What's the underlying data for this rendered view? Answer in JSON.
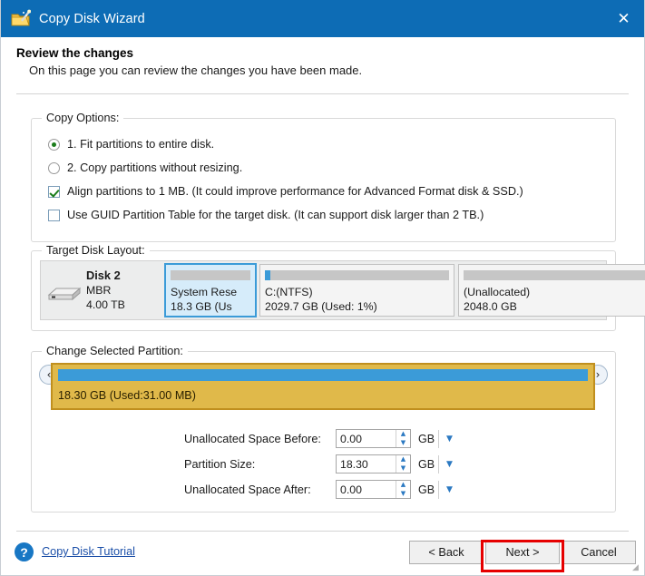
{
  "window": {
    "title": "Copy Disk Wizard",
    "icon": "wizard-disk-icon",
    "close_label": "✕",
    "accent_color": "#0d6cb5"
  },
  "header": {
    "heading": "Review the changes",
    "subheading": "On this page you can review the changes you have been made."
  },
  "copy_options": {
    "legend": "Copy Options:",
    "items": [
      {
        "type": "radio",
        "checked": true,
        "label": "1. Fit partitions to entire disk."
      },
      {
        "type": "radio",
        "checked": false,
        "label": "2. Copy partitions without resizing."
      },
      {
        "type": "checkbox",
        "checked": true,
        "label": "Align partitions to 1 MB.  (It could improve performance for Advanced Format disk & SSD.)"
      },
      {
        "type": "checkbox",
        "checked": false,
        "label": "Use GUID Partition Table for the target disk. (It can support disk larger than 2 TB.)"
      }
    ]
  },
  "target_disk": {
    "legend": "Target Disk Layout:",
    "disk": {
      "name": "Disk 2",
      "scheme": "MBR",
      "size": "4.00 TB"
    },
    "partitions": [
      {
        "name": "System Rese",
        "size": "18.3 GB (Us",
        "used_pct": 0,
        "selected": true,
        "bar_color": "#c6c6c6"
      },
      {
        "name": "C:(NTFS)",
        "size": "2029.7 GB (Used: 1%)",
        "used_pct": 3,
        "selected": false,
        "bar_color": "#c6c6c6"
      },
      {
        "name": "(Unallocated)",
        "size": "2048.0 GB",
        "used_pct": 0,
        "selected": false,
        "bar_color": "#c6c6c6"
      }
    ]
  },
  "change_partition": {
    "legend": "Change Selected Partition:",
    "bar_label": "18.30 GB (Used:31.00 MB)",
    "bar_fill_color": "#3b9bd8",
    "panel_color": "#e0b94a",
    "nav_left": "‹",
    "nav_right": "›",
    "fields": [
      {
        "label": "Unallocated Space Before:",
        "value": "0.00",
        "unit": "GB"
      },
      {
        "label": "Partition Size:",
        "value": "18.30",
        "unit": "GB"
      },
      {
        "label": "Unallocated Space After:",
        "value": "0.00",
        "unit": "GB"
      }
    ],
    "spin_up": "▲",
    "spin_down": "▼",
    "dropdown_caret": "▼"
  },
  "footer": {
    "help_icon": "question-mark-icon",
    "help_glyph": "?",
    "tutorial_link": "Copy Disk Tutorial",
    "back_label": "< Back",
    "next_label": "Next >",
    "cancel_label": "Cancel",
    "highlight_color": "#e60000",
    "grip": "◢"
  }
}
